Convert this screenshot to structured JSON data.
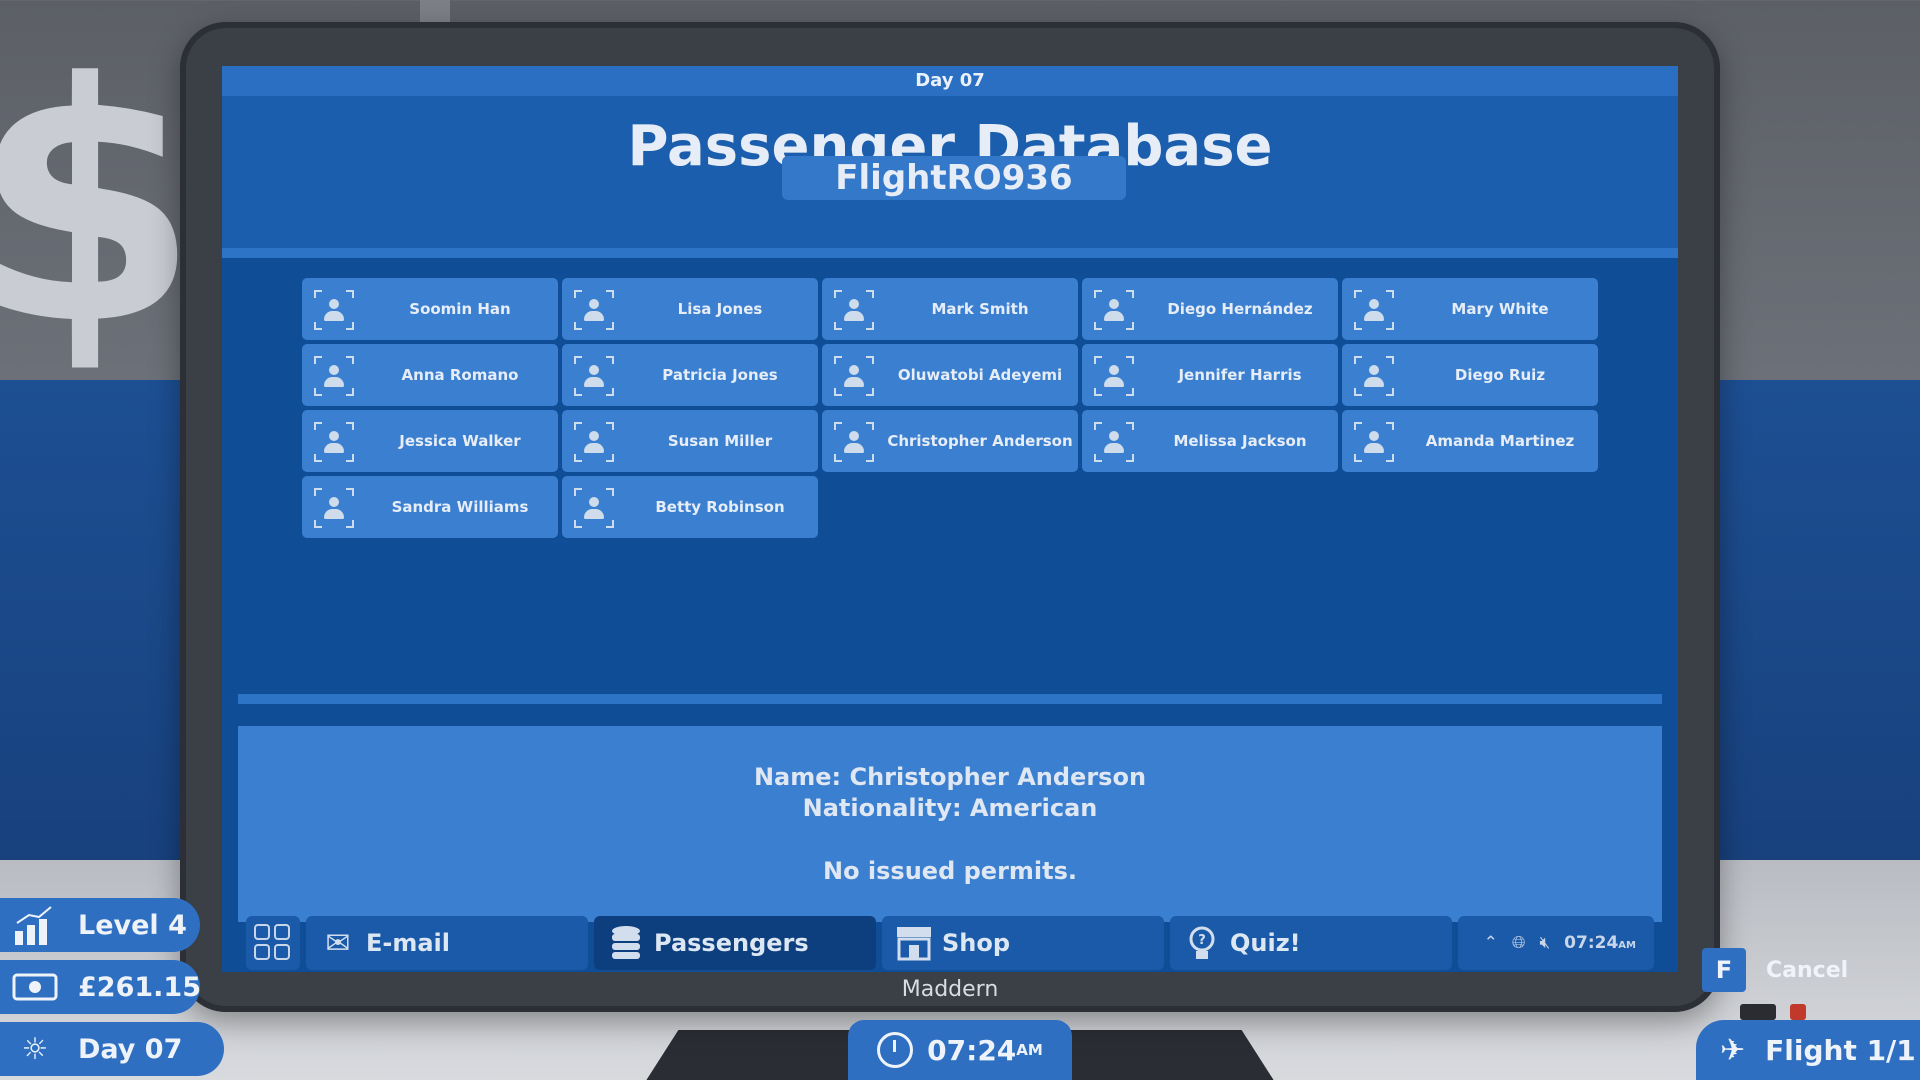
{
  "screen": {
    "topbar_day": "Day 07",
    "title": "Passenger Database",
    "flight_code": "FlightRO936"
  },
  "passengers": [
    "Soomin Han",
    "Lisa Jones",
    "Mark Smith",
    "Diego Hernández",
    "Mary White",
    "Anna Romano",
    "Patricia Jones",
    "Oluwatobi Adeyemi",
    "Jennifer Harris",
    "Diego Ruiz",
    "Jessica Walker",
    "Susan Miller",
    "Christopher Anderson",
    "Melissa Jackson",
    "Amanda Martinez",
    "Sandra Williams",
    "Betty Robinson"
  ],
  "details": {
    "name_line": "Name: Christopher Anderson",
    "nationality_line": "Nationality: American",
    "permits_line": "No issued permits."
  },
  "taskbar": {
    "email": "E-mail",
    "passengers": "Passengers",
    "shop": "Shop",
    "quiz": "Quiz!",
    "clock": "07:24",
    "clock_suffix": "AM"
  },
  "monitor": {
    "brand": "Maddern"
  },
  "hud": {
    "level": "Level 4",
    "money": "£261.15",
    "day": "Day 07",
    "time": "07:24",
    "time_suffix": "AM",
    "cancel_key": "F",
    "cancel_label": "Cancel",
    "flight": "Flight 1/1"
  },
  "background": {
    "sign_glyph": "$"
  },
  "icons": {
    "level": "bar-chart-star-icon",
    "money": "banknote-icon",
    "day": "sun-moon-icon",
    "flight": "plane-icon"
  },
  "colors": {
    "screen_bg": "#0f4d97",
    "card_bg": "#3b7fd0",
    "hud_bg": "#2f6fc1"
  }
}
